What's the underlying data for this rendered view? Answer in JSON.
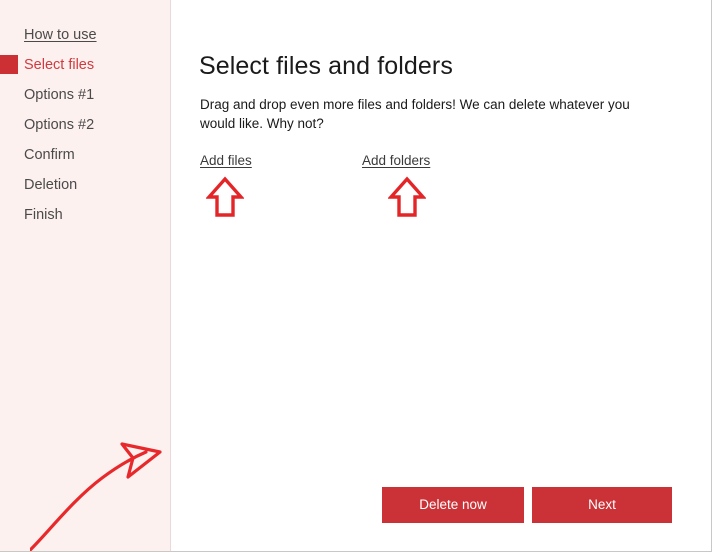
{
  "window": {
    "controls": [
      {
        "name": "more-options",
        "icon": "ellipsis-icon",
        "label": "•••"
      },
      {
        "name": "minimize",
        "icon": "minimize-icon",
        "label": "—"
      },
      {
        "name": "close",
        "icon": "close-icon",
        "label": "✕"
      }
    ]
  },
  "sidebar": {
    "active_index": 1,
    "items": [
      {
        "label": "How to use",
        "style": "link"
      },
      {
        "label": "Select files",
        "style": "active"
      },
      {
        "label": "Options #1",
        "style": "normal"
      },
      {
        "label": "Options #2",
        "style": "normal"
      },
      {
        "label": "Confirm",
        "style": "normal"
      },
      {
        "label": "Deletion",
        "style": "normal"
      },
      {
        "label": "Finish",
        "style": "normal"
      }
    ]
  },
  "main": {
    "title": "Select files and folders",
    "description": "Drag and drop even more files and folders! We can delete whatever you would like. Why not?",
    "add_files_label": "Add files",
    "add_folders_label": "Add folders"
  },
  "footer": {
    "delete_label": "Delete now",
    "next_label": "Next"
  },
  "colors": {
    "accent_red": "#ca3237",
    "marker_red": "#cc3034",
    "arrow_red": "#e42528",
    "annotation_red": "#e8292c",
    "sidebar_bg": "#fdf1f0",
    "active_text": "#cf3b3f",
    "text": "#1a1a1a"
  }
}
